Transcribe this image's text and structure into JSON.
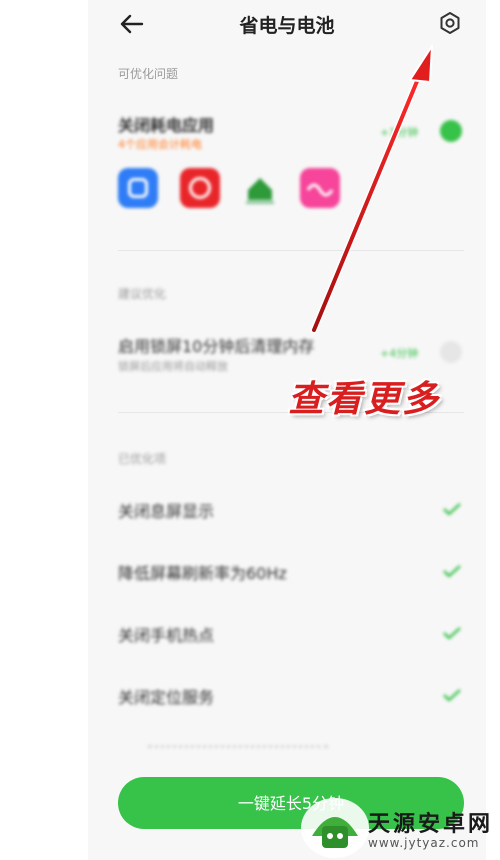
{
  "header": {
    "title": "省电与电池",
    "back_icon": "arrow-left-icon",
    "settings_icon": "settings-hexagon-icon"
  },
  "sections": {
    "optimizable": {
      "label": "可优化问题",
      "close_apps": {
        "title": "关闭耗电应用",
        "subtitle": "4个应用会计耗电",
        "tag": "+1分钟",
        "checked": true
      }
    },
    "suggest": {
      "label": "建议优化",
      "lock_screen": {
        "title": "启用锁屏10分钟后清理内存",
        "subtitle": "锁屏后应用将自动释放",
        "tag": "+4分钟",
        "checked": false
      }
    },
    "optimized": {
      "label": "已优化项",
      "items": [
        "关闭息屏显示",
        "降低屏幕刷新率为60Hz",
        "关闭手机热点",
        "关闭定位服务"
      ]
    }
  },
  "app_icons": [
    "blue-app-icon",
    "red-app-icon",
    "green-house-icon",
    "pink-wave-icon"
  ],
  "bottom_button": {
    "label": "一键延长5分钟"
  },
  "annotation": {
    "text": "查看更多"
  },
  "watermark": {
    "title": "天源安卓网",
    "url": "www.jytyaz.com"
  },
  "colors": {
    "accent_green": "#37c24a",
    "orange": "#ff7a22",
    "annotation_red": "#d81e1e"
  }
}
